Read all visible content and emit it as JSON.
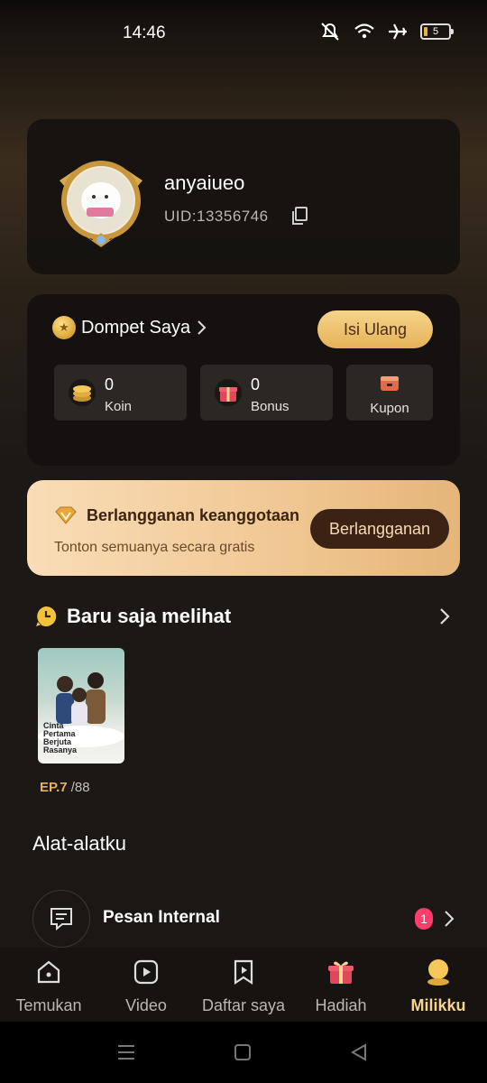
{
  "status": {
    "time": "14:46",
    "battery": "5"
  },
  "profile": {
    "username": "anyaiueo",
    "uid": "UID:13356746"
  },
  "wallet": {
    "title": "Dompet Saya",
    "topup_label": "Isi Ulang",
    "koin": {
      "value": "0",
      "label": "Koin"
    },
    "bonus": {
      "value": "0",
      "label": "Bonus"
    },
    "kupon": {
      "label": "Kupon"
    }
  },
  "membership": {
    "title": "Berlangganan keanggotaan",
    "subtitle": "Tonton semuanya secara gratis",
    "button_label": "Berlangganan"
  },
  "recent": {
    "title": "Baru saja melihat",
    "items": [
      {
        "poster_title": "Cinta Pertama Berjuta Rasanya",
        "episode": "EP.7",
        "total": "/88"
      }
    ]
  },
  "tools": {
    "title": "Alat-alatku",
    "items": [
      {
        "label": "Pesan Internal",
        "badge": "1"
      }
    ]
  },
  "nav": {
    "items": [
      {
        "label": "Temukan",
        "icon": "home-icon"
      },
      {
        "label": "Video",
        "icon": "play-icon"
      },
      {
        "label": "Daftar saya",
        "icon": "bookmark-icon"
      },
      {
        "label": "Hadiah",
        "icon": "gift-icon"
      },
      {
        "label": "Milikku",
        "icon": "profile-icon",
        "active": true
      }
    ]
  },
  "colors": {
    "accent": "#f6d48a",
    "badge": "#ff3d6b",
    "member_bg": "#f0c792"
  }
}
